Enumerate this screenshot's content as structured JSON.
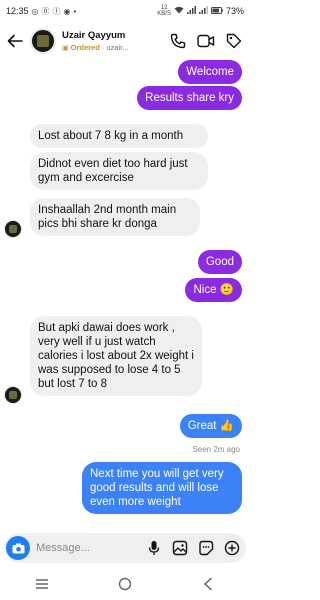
{
  "status": {
    "time": "12:35",
    "battery": "73%",
    "net_speed": "12",
    "net_unit": "KB/S"
  },
  "header": {
    "name": "Uzair Qayyum",
    "ordered_label": "Ordered",
    "sub_suffix": "· uzair..."
  },
  "messages": [
    {
      "id": "m1",
      "dir": "out",
      "text": "Welcome"
    },
    {
      "id": "m2",
      "dir": "out",
      "text": "Results share kry"
    },
    {
      "id": "m3",
      "dir": "in",
      "text": "Lost about 7 8 kg in a month"
    },
    {
      "id": "m4",
      "dir": "in",
      "text": "Didnot even diet too hard just gym and excercise"
    },
    {
      "id": "m5",
      "dir": "in",
      "text": "Inshaallah 2nd month main pics bhi share kr donga"
    },
    {
      "id": "m6",
      "dir": "out",
      "text": "Good"
    },
    {
      "id": "m7",
      "dir": "out",
      "text": "Nice 🙂"
    },
    {
      "id": "m8",
      "dir": "in",
      "text": "But apki dawai does work , very well if u just watch calories i lost about 2x weight i was supposed to lose  4 to 5 but lost 7 to 8"
    },
    {
      "id": "m9",
      "dir": "out",
      "text": "Great 👍"
    },
    {
      "id": "m10",
      "dir": "out",
      "text": "Next time you will get very good results and will lose even more weight"
    }
  ],
  "seen_label": "Seen 2m ago",
  "composer": {
    "placeholder": "Message..."
  },
  "colors": {
    "outgoing_purple": "#8a2be2",
    "outgoing_blue": "#3b82f6",
    "incoming": "#efefef",
    "camera": "#1d7ff2",
    "ordered": "#c4922a"
  }
}
